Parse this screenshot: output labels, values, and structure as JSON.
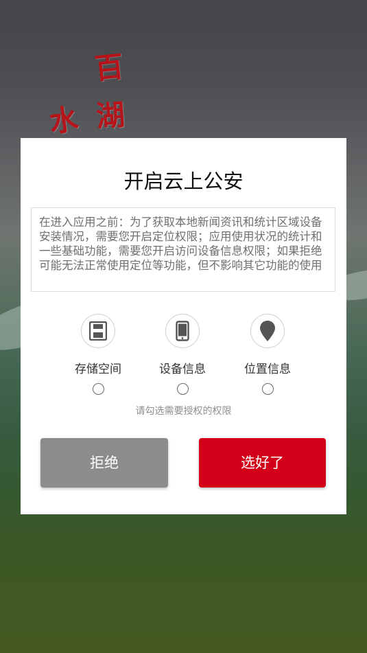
{
  "background": {
    "calligraphy_1": "百",
    "calligraphy_2": "湖",
    "calligraphy_3": "水"
  },
  "dialog": {
    "title": "开启云上公安",
    "notice": "在进入应用之前：为了获取本地新闻资讯和统计区域设备安装情况，需要您开启定位权限；应用使用状况的统计和一些基础功能，需要您开启访问设备信息权限；如果拒绝可能无法正常使用定位等功能，但不影响其它功能的使用",
    "permissions": [
      {
        "icon": "floppy-disk-icon",
        "label": "存储空间",
        "checked": false
      },
      {
        "icon": "phone-icon",
        "label": "设备信息",
        "checked": false
      },
      {
        "icon": "location-pin-icon",
        "label": "位置信息",
        "checked": false
      }
    ],
    "hint": "请勾选需要授权的权限",
    "refuse_label": "拒绝",
    "confirm_label": "选好了"
  },
  "colors": {
    "confirm_button": "#d30019",
    "refuse_button": "#8c8c8c",
    "calligraphy": "#b5141a"
  }
}
